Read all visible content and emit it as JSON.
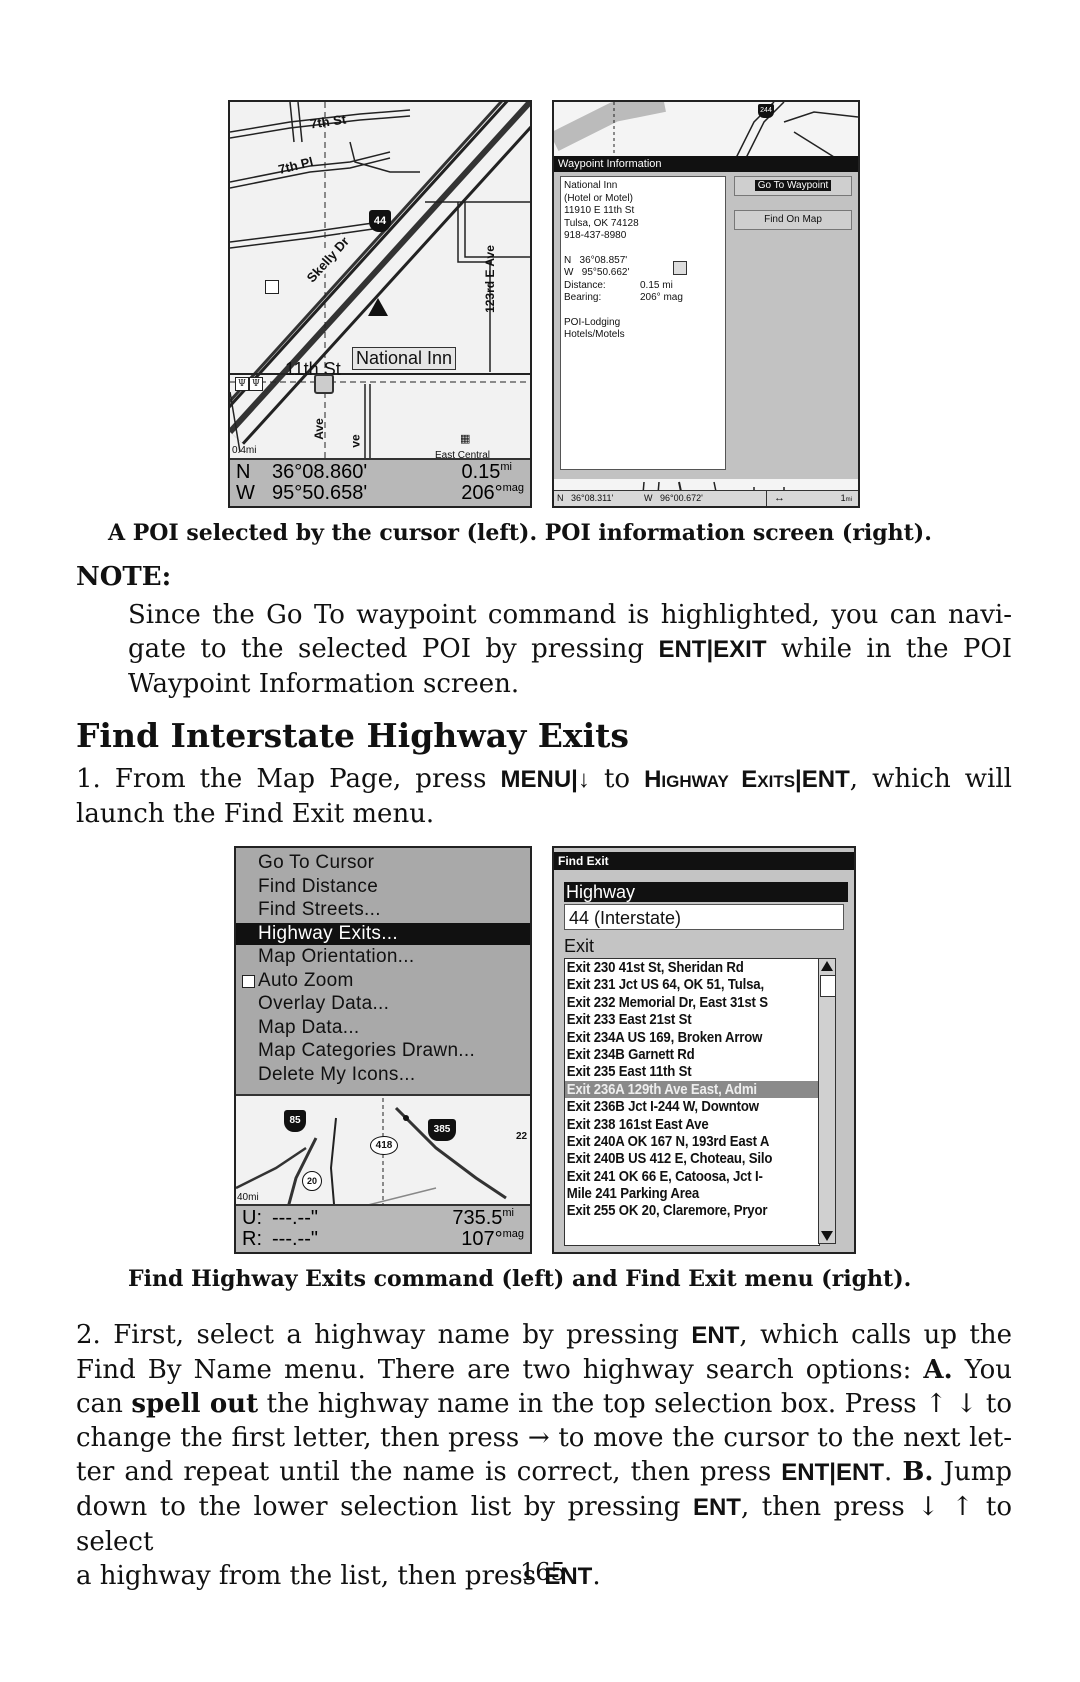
{
  "figure1": {
    "left_screen": {
      "streets": [
        "7th St",
        "7th Pl",
        "Skelly Dr",
        "123rd E Ave",
        "11th St",
        "Ave",
        "ve",
        "East Central"
      ],
      "interstate_shield": "44",
      "poi_label": "National Inn",
      "scale": "0.4mi",
      "lat_prefix": "N",
      "lat": "36°08.860'",
      "lon_prefix": "W",
      "lon": "95°50.658'",
      "distance": "0.15",
      "distance_unit": "mi",
      "bearing": "206°",
      "bearing_unit": "mag"
    },
    "right_screen": {
      "title": "Waypoint Information",
      "shield": "244",
      "info_lines": [
        "National Inn",
        "(Hotel or Motel)",
        "11910 E 11th St",
        "Tulsa, OK 74128",
        "918-437-8980"
      ],
      "lat": "N   36°08.857'",
      "lon": "W   95°50.662'",
      "distance_label": "Distance:",
      "distance_value": "0.15 mi",
      "bearing_label": "Bearing:",
      "bearing_value": "206° mag",
      "category_lines": [
        "POI-Lodging",
        "Hotels/Motels"
      ],
      "buttons": {
        "goto": "Go To Waypoint",
        "find_on_map": "Find On Map"
      },
      "status": {
        "lat": "N   36°08.311'",
        "lon": "W   96°00.672'",
        "arrow": "↔",
        "scale": "1",
        "scale_unit": "mi"
      }
    },
    "caption": "A POI selected by the cursor (left). POI information screen (right)."
  },
  "note": {
    "heading": "NOTE:",
    "text_1": "Since the Go To waypoint command is highlighted, you can navi-",
    "text_2a": "gate to the selected POI by pressing ",
    "text_2key": "ENT|EXIT",
    "text_2b": " while in the POI",
    "text_3": "Waypoint Information screen."
  },
  "section": {
    "heading": "Find Interstate Highway Exits",
    "step1": {
      "a": "1. From the Map Page, press ",
      "key1": "MENU|↓",
      "b": " to ",
      "key2": "Highway Exits|ENT",
      "c": ", which will",
      "d": "launch the Find Exit menu."
    }
  },
  "figure2": {
    "menu_items": [
      {
        "label": "Go To Cursor",
        "selected": false,
        "checkbox": false
      },
      {
        "label": "Find Distance",
        "selected": false,
        "checkbox": false
      },
      {
        "label": "Find Streets...",
        "selected": false,
        "checkbox": false
      },
      {
        "label": "Highway Exits...",
        "selected": true,
        "checkbox": false
      },
      {
        "label": "Map Orientation...",
        "selected": false,
        "checkbox": false
      },
      {
        "label": "Auto Zoom",
        "selected": false,
        "checkbox": true,
        "checked": false
      },
      {
        "label": "Overlay Data...",
        "selected": false,
        "checkbox": false
      },
      {
        "label": "Map Data...",
        "selected": false,
        "checkbox": false
      },
      {
        "label": "Map Categories Drawn...",
        "selected": false,
        "checkbox": false
      },
      {
        "label": "Delete My Icons...",
        "selected": false,
        "checkbox": false
      }
    ],
    "map": {
      "shields": [
        "85",
        "418",
        "385",
        "20",
        "22"
      ],
      "scale": "40mi",
      "u_label": "U:",
      "u_value": "---.--\"",
      "r_label": "R:",
      "r_value": "---.--\"",
      "distance": "735.5",
      "distance_unit": "mi",
      "bearing": "107°",
      "bearing_unit": "mag"
    },
    "find_exit": {
      "title": "Find Exit",
      "highway_label": "Highway",
      "highway_value": "44 (Interstate)",
      "exit_label": "Exit",
      "exits": [
        "Exit 230 41st St, Sheridan Rd",
        "Exit 231 Jct US 64, OK 51, Tulsa,",
        "Exit 232 Memorial Dr, East 31st S",
        "Exit 233 East 21st St",
        "Exit 234A US 169, Broken Arrow",
        "Exit 234B Garnett Rd",
        "Exit 235 East 11th St",
        "Exit 236A 129th Ave East, Admi",
        "Exit 236B Jct I-244 W, Downtow",
        "Exit 238 161st East Ave",
        "Exit 240A OK 167 N, 193rd East A",
        "Exit 240B US 412 E, Choteau, Silo",
        "Exit 241 OK 66 E, Catoosa, Jct I-",
        "Mile 241 Parking Area",
        "Exit 255 OK 20, Claremore, Pryor"
      ],
      "selected_index": 7
    },
    "caption": "Find Highway Exits command (left) and Find Exit menu (right)."
  },
  "step2": {
    "l1a": "2. First, select a highway name by pressing ",
    "l1key": "ENT",
    "l1b": ", which calls up the",
    "l2a": "Find By Name menu. There are two highway search options: ",
    "l2bold": "A.",
    "l2b": " You",
    "l3a": "can ",
    "l3bold": "spell out",
    "l3b": " the highway name in the top selection box. Press ↑ ↓ to",
    "l4": "change the first letter, then press → to move the cursor to the next let-",
    "l5a": "ter and repeat until the name is correct, then press ",
    "l5key": "ENT|ENT",
    "l5b": ". ",
    "l5bold": "B.",
    "l5c": " Jump",
    "l6a": "down to the lower selection list by pressing ",
    "l6key": "ENT",
    "l6b": ", then press ↓ ↑ to select",
    "l7a": "a highway from the list, then press ",
    "l7key": "ENT",
    "l7b": "."
  },
  "page_number": "165"
}
